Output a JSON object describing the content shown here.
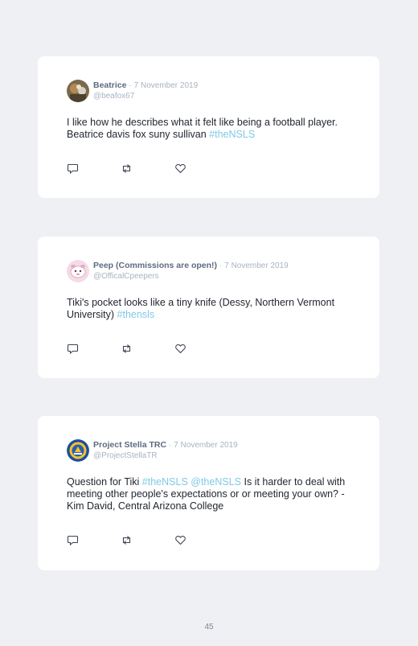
{
  "tweets": [
    {
      "name": "Beatrice",
      "separator": "·",
      "date": "7 November 2019",
      "handle": "@beafox67",
      "text_before": "I like how he describes what it felt like being a football player. Beatrice davis fox suny sullivan ",
      "tag": "#theNSLS",
      "text_middle": "",
      "tag2": "",
      "text_after": "",
      "avatar_icon": "photo-avatar-icon"
    },
    {
      "name": "Peep (Commissions are open!)",
      "separator": "·",
      "date": "7 November 2019",
      "handle": "@OfficalCpeepers",
      "text_before": "Tiki's pocket looks like a tiny knife (Dessy, Northern Vermont University) ",
      "tag": "#thensls",
      "text_middle": "",
      "tag2": "",
      "text_after": "",
      "avatar_icon": "pink-creature-avatar-icon"
    },
    {
      "name": "Project Stella TRC",
      "separator": "·",
      "date": "7 November 2019",
      "handle": "@ProjectStellaTR",
      "text_before": "Question for Tiki ",
      "tag": "#theNSLS",
      "text_middle": " ",
      "tag2": "@theNSLS",
      "text_after": " Is it harder to deal with meeting other people's expectations or or meeting your own? - Kim David, Central Arizona College",
      "avatar_icon": "seal-avatar-icon"
    }
  ],
  "page_number": "45",
  "colors": {
    "background": "#eef0f3",
    "card": "#ffffff",
    "name": "#5c6b80",
    "muted": "#a9b3c0",
    "hashtag": "#7fc8e6",
    "body_text": "#222730"
  },
  "icons": [
    "reply-icon",
    "retweet-icon",
    "like-icon"
  ]
}
